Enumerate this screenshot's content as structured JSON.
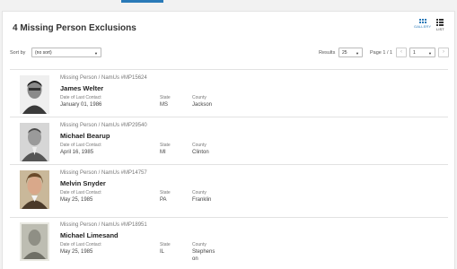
{
  "header": {
    "title": "4 Missing Person Exclusions"
  },
  "view_toggle": {
    "gallery_label": "GALLERY",
    "list_label": "LIST"
  },
  "toolbar": {
    "sort_label": "Sort by",
    "sort_value": "(no sort)",
    "results_label": "Results",
    "results_value": "25",
    "page_label": "Page 1 / 1",
    "page_value": "1",
    "prev_symbol": "‹",
    "next_symbol": "›",
    "caret": "▼"
  },
  "field_labels": {
    "date": "Date of Last Contact",
    "state": "State",
    "county": "County"
  },
  "persons": [
    {
      "case": "Missing Person / NamUs #MP15624",
      "name": "James Welter",
      "date": "January 01, 1986",
      "state": "MS",
      "county": "Jackson"
    },
    {
      "case": "Missing Person / NamUs #MP29540",
      "name": "Michael Bearup",
      "date": "April 16, 1985",
      "state": "MI",
      "county": "Clinton"
    },
    {
      "case": "Missing Person / NamUs #MP14757",
      "name": "Melvin Snyder",
      "date": "May 25, 1985",
      "state": "PA",
      "county": "Franklin"
    },
    {
      "case": "Missing Person / NamUs #MP18951",
      "name": "Michael Limesand",
      "date": "May 25, 1985",
      "state": "IL",
      "county": "Stephenson"
    }
  ],
  "colors": {
    "accent": "#2a7ab8",
    "card_border": "#e2e2e2",
    "label_gray": "#777777"
  }
}
